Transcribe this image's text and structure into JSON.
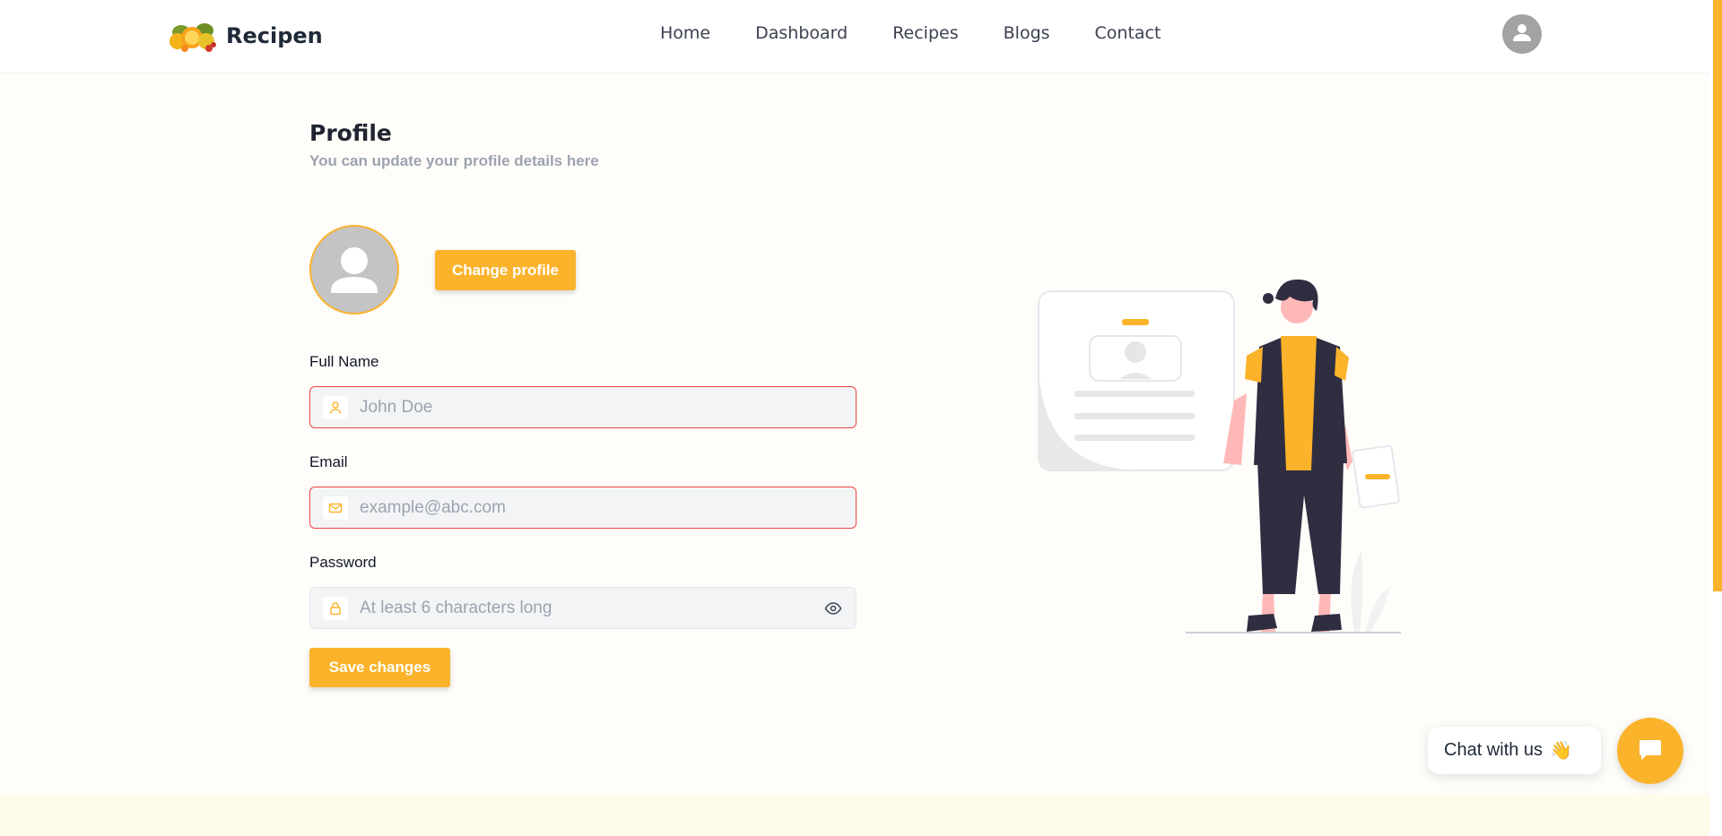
{
  "brand": {
    "name": "Recipen",
    "logo_icon": "fruit-logo-icon"
  },
  "nav": {
    "items": [
      {
        "label": "Home"
      },
      {
        "label": "Dashboard"
      },
      {
        "label": "Recipes"
      },
      {
        "label": "Blogs"
      },
      {
        "label": "Contact"
      }
    ],
    "avatar_icon": "user-avatar-icon"
  },
  "profile": {
    "title": "Profile",
    "subtitle": "You can update your profile details here",
    "change_button": "Change profile",
    "fields": {
      "full_name": {
        "label": "Full Name",
        "placeholder": "John Doe",
        "value": "",
        "icon": "user-icon"
      },
      "email": {
        "label": "Email",
        "placeholder": "example@abc.com",
        "value": "",
        "icon": "mail-icon"
      },
      "password": {
        "label": "Password",
        "placeholder": "At least 6 characters long",
        "value": "",
        "icon": "lock-icon"
      }
    },
    "save_button": "Save changes"
  },
  "chat": {
    "label": "Chat with us",
    "emoji": "👋",
    "icon": "chat-bubble-icon"
  },
  "colors": {
    "accent": "#fbb32b",
    "error": "#ef4444",
    "muted": "#9ca3af",
    "illustration_dark": "#2f2e41"
  }
}
